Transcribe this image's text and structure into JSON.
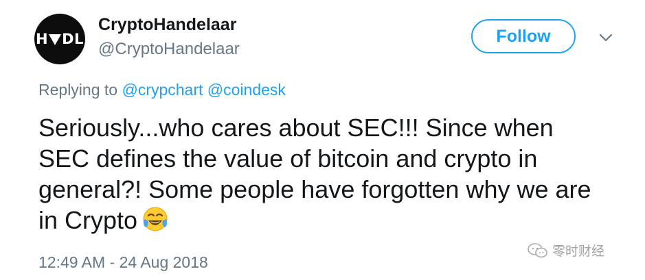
{
  "author": {
    "avatar_text_left": "H",
    "avatar_text_right": "DL",
    "display_name": "CryptoHandelaar",
    "handle": "@CryptoHandelaar"
  },
  "follow_button_label": "Follow",
  "replying": {
    "prefix": "Replying to",
    "mentions": [
      "@crypchart",
      "@coindesk"
    ]
  },
  "tweet": {
    "text": "Seriously...who cares about SEC!!! Since when SEC defines the value of bitcoin and crypto in general?! Some people have forgotten why we are in Crypto",
    "emoji": "face-with-tears-of-joy-icon"
  },
  "timestamp": "12:49 AM - 24 Aug 2018",
  "watermark": "零时财经",
  "colors": {
    "accent": "#1da1f2",
    "secondary_text": "#657786",
    "primary_text": "#14171a"
  }
}
